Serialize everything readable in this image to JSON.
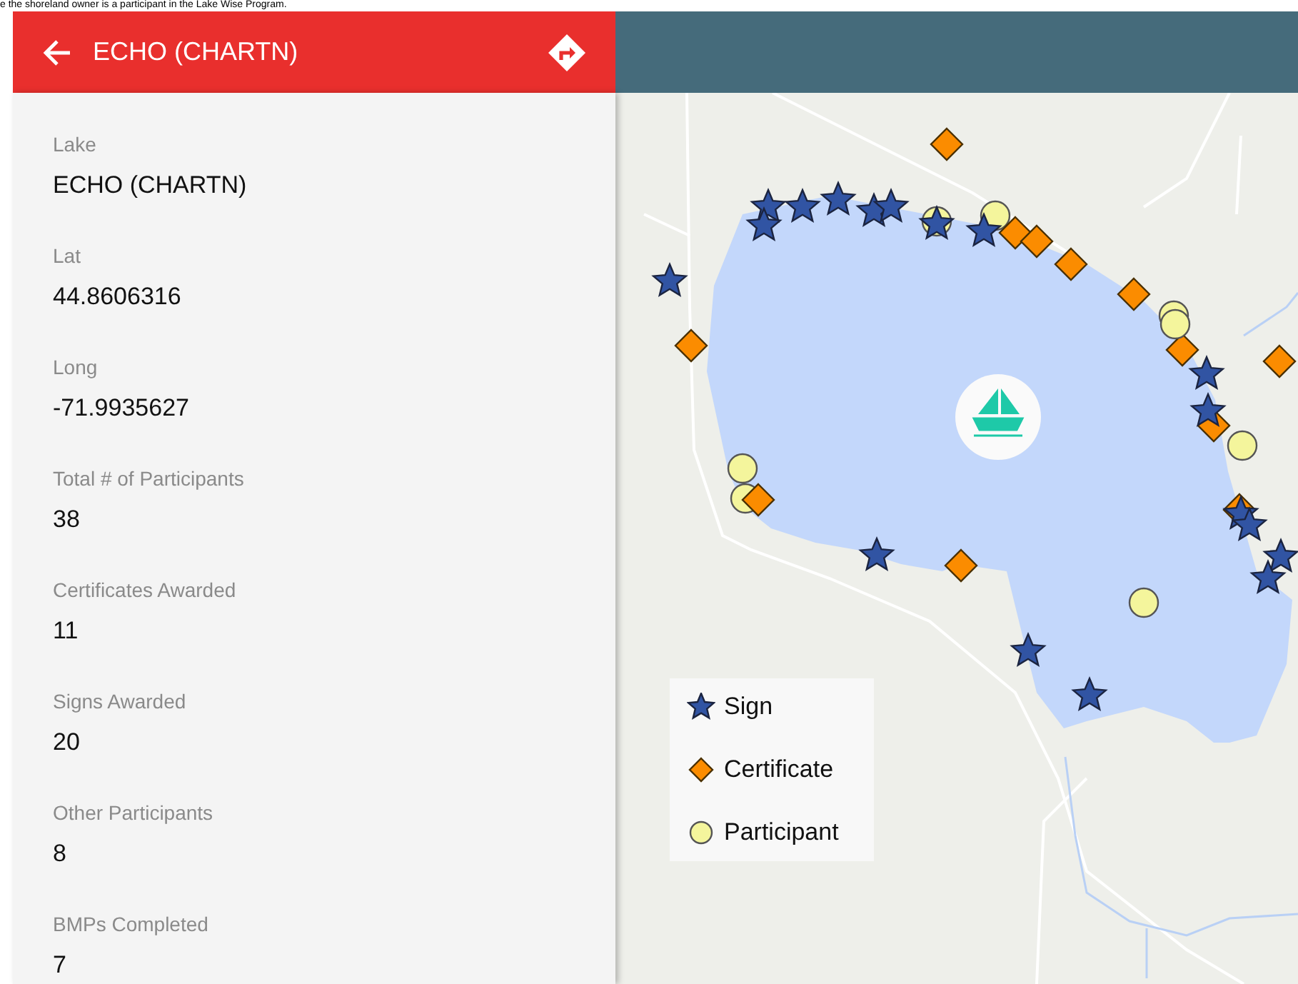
{
  "caption": "e the shoreland owner is a participant in the Lake Wise Program.",
  "header": {
    "title": "ECHO (CHARTN)"
  },
  "fields": [
    {
      "label": "Lake",
      "value": "ECHO (CHARTN)"
    },
    {
      "label": "Lat",
      "value": "44.8606316"
    },
    {
      "label": "Long",
      "value": "-71.9935627"
    },
    {
      "label": "Total # of Participants",
      "value": "38"
    },
    {
      "label": "Certificates Awarded",
      "value": "11"
    },
    {
      "label": "Signs Awarded",
      "value": "20"
    },
    {
      "label": "Other Participants",
      "value": "8"
    },
    {
      "label": "BMPs Completed",
      "value": "7"
    }
  ],
  "legend": [
    {
      "kind": "star",
      "label": "Sign"
    },
    {
      "kind": "diamond",
      "label": "Certificate"
    },
    {
      "kind": "circle",
      "label": "Participant"
    }
  ]
}
